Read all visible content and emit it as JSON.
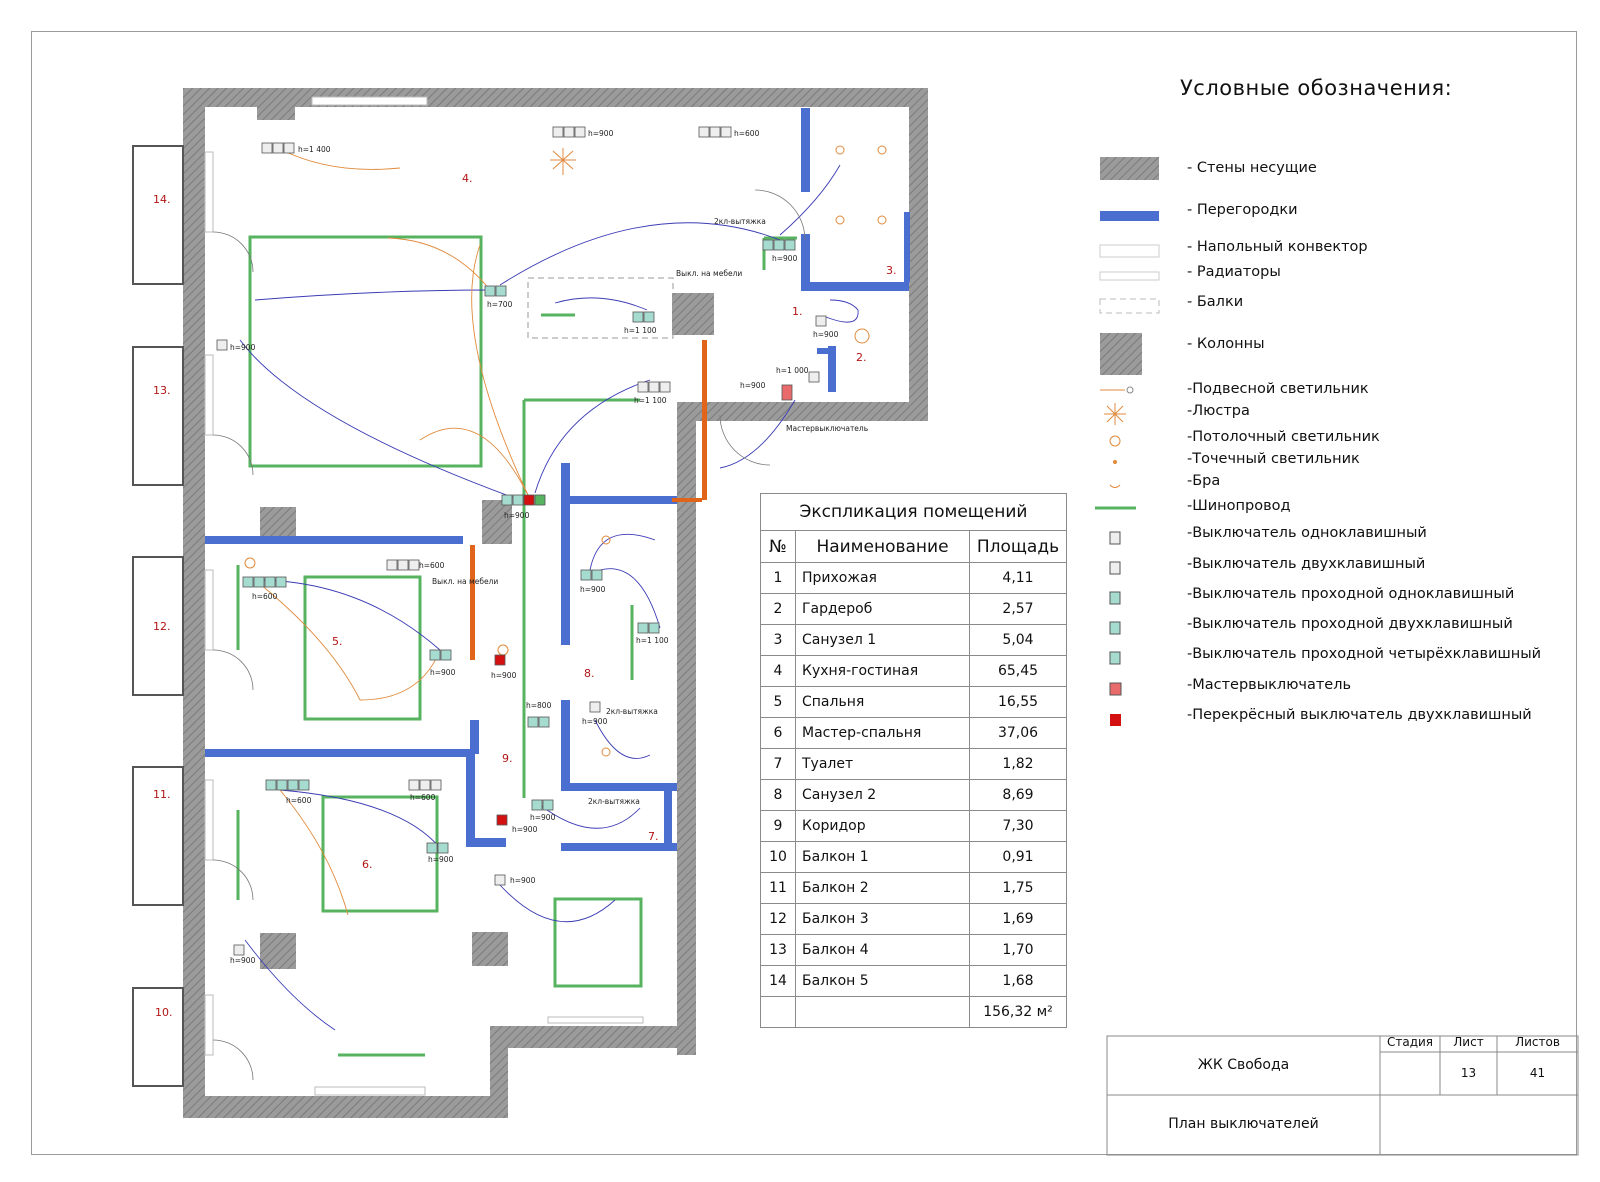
{
  "legend": {
    "title": "Условные обозначения:",
    "items": [
      {
        "label": "- Стены несущие",
        "icon": "hatched-wall-swatch"
      },
      {
        "label": "- Перегородки",
        "icon": "blue-partition-swatch"
      },
      {
        "label": "- Напольный конвектор",
        "icon": "floor-convector-swatch"
      },
      {
        "label": "- Радиаторы",
        "icon": "radiator-swatch"
      },
      {
        "label": "- Балки",
        "icon": "beam-swatch"
      },
      {
        "label": "- Колонны",
        "icon": "column-swatch"
      },
      {
        "label": "-Подвесной светильник",
        "icon": "pendant-lamp-icon"
      },
      {
        "label": "-Люстра",
        "icon": "chandelier-icon"
      },
      {
        "label": "-Потолочный светильник",
        "icon": "ceiling-lamp-icon"
      },
      {
        "label": "-Точечный светильник",
        "icon": "spot-lamp-icon"
      },
      {
        "label": "-Бра",
        "icon": "wall-lamp-icon"
      },
      {
        "label": "-Шинопровод",
        "icon": "busbar-icon"
      },
      {
        "label": "-Выключатель одноклавишный",
        "icon": "single-switch-icon"
      },
      {
        "label": "-Выключатель двухклавишный",
        "icon": "double-switch-icon"
      },
      {
        "label": "-Выключатель проходной одноклавишный",
        "icon": "pass-single-switch-icon"
      },
      {
        "label": "-Выключатель проходной двухклавишный",
        "icon": "pass-double-switch-icon"
      },
      {
        "label": "-Выключатель проходной четырёхклавишный",
        "icon": "pass-quad-switch-icon"
      },
      {
        "label": "-Мастервыключатель",
        "icon": "master-switch-icon"
      },
      {
        "label": "-Перекрёсный выключатель двухклавишный",
        "icon": "cross-switch-icon"
      }
    ],
    "colors": {
      "wall": "#8f8f8f",
      "partition": "#4a6fd1",
      "busbar": "#57b35f",
      "master": "#e86a6a",
      "cross": "#d41111",
      "pass": "#a6dcd0",
      "orange_wall": "#e0641a",
      "wire": "#3b3bb5",
      "lamp": "#e08a3c"
    }
  },
  "explication": {
    "title": "Экспликация помещений",
    "headers": [
      "№",
      "Наименование",
      "Площадь"
    ],
    "rows": [
      {
        "n": "1",
        "name": "Прихожая",
        "area": "4,11"
      },
      {
        "n": "2",
        "name": "Гардероб",
        "area": "2,57"
      },
      {
        "n": "3",
        "name": "Санузел 1",
        "area": "5,04"
      },
      {
        "n": "4",
        "name": "Кухня-гостиная",
        "area": "65,45"
      },
      {
        "n": "5",
        "name": "Спальня",
        "area": "16,55"
      },
      {
        "n": "6",
        "name": "Мастер-спальня",
        "area": "37,06"
      },
      {
        "n": "7",
        "name": "Туалет",
        "area": "1,82"
      },
      {
        "n": "8",
        "name": "Санузел 2",
        "area": "8,69"
      },
      {
        "n": "9",
        "name": "Коридор",
        "area": "7,30"
      },
      {
        "n": "10",
        "name": "Балкон 1",
        "area": "0,91"
      },
      {
        "n": "11",
        "name": "Балкон 2",
        "area": "1,75"
      },
      {
        "n": "12",
        "name": "Балкон 3",
        "area": "1,69"
      },
      {
        "n": "13",
        "name": "Балкон 4",
        "area": "1,70"
      },
      {
        "n": "14",
        "name": "Балкон 5",
        "area": "1,68"
      }
    ],
    "total": "156,32 м²"
  },
  "stamp": {
    "project": "ЖК Свобода",
    "sheet_title": "План выключателей",
    "stage_label": "Стадия",
    "sheet_label": "Лист",
    "sheets_label": "Листов",
    "sheet_no": "13",
    "sheets_total": "41"
  },
  "plan": {
    "room_numbers": [
      "1.",
      "2.",
      "3.",
      "4.",
      "5.",
      "6.",
      "7.",
      "8.",
      "9.",
      "10.",
      "11.",
      "12.",
      "13.",
      "14."
    ],
    "heights": [
      "h=1 400",
      "h=900",
      "h=600",
      "h=900",
      "h=700",
      "h=1 100",
      "h=900",
      "h=900",
      "h=1 000",
      "h=900",
      "h=1 100",
      "h=900",
      "h=600",
      "h=600",
      "h=900",
      "h=900",
      "h=900",
      "h=1 100",
      "h=900",
      "h=800",
      "h=900",
      "h=900",
      "h=600",
      "h=600",
      "h=900",
      "h=900",
      "h=900"
    ],
    "notes": {
      "kitchen_hood": "2кл-вытяжка",
      "furniture_switch": "Выкл. на мебели",
      "master_switch": "Мастервыключатель",
      "bath_hood": "2кл-вытяжка",
      "toilet_hood": "2кл-вытяжка"
    }
  }
}
